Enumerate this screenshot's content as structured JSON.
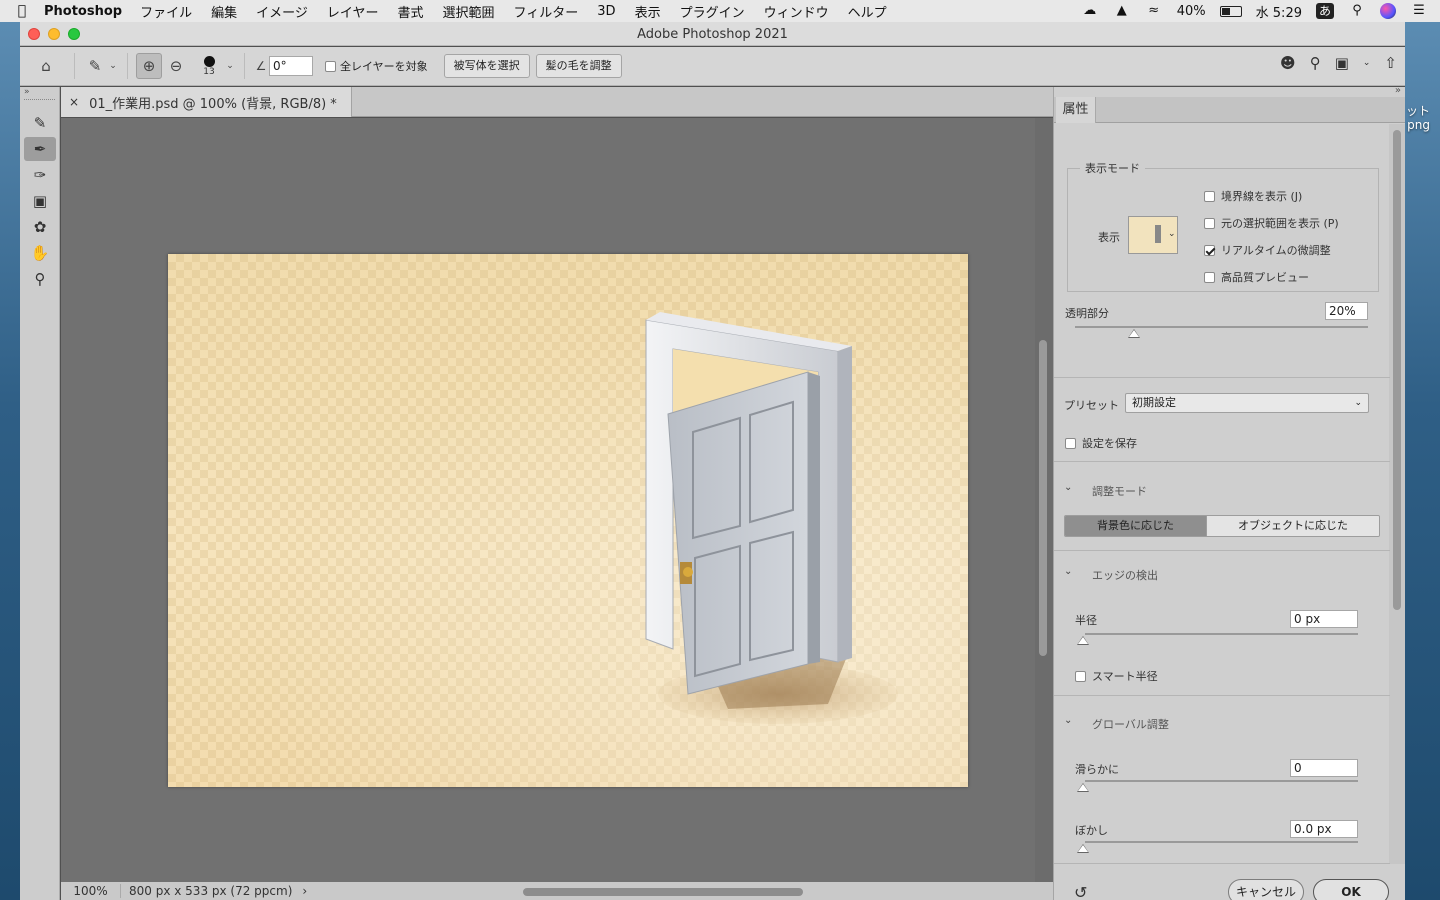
{
  "menubar": {
    "app_name": "Photoshop",
    "items": [
      "ファイル",
      "編集",
      "イメージ",
      "レイヤー",
      "書式",
      "選択範囲",
      "フィルター",
      "3D",
      "表示",
      "プラグイン",
      "ウィンドウ",
      "ヘルプ"
    ],
    "battery": "40%",
    "clock": "水 5:29",
    "ime": "あ"
  },
  "desktop": {
    "label_top": "ット",
    "label_bottom": "png"
  },
  "window": {
    "title": "Adobe Photoshop 2021"
  },
  "options": {
    "brush_size": "13",
    "angle_value": "0°",
    "sample_all_layers": "全レイヤーを対象",
    "select_subject": "被写体を選択",
    "refine_hair": "髪の毛を調整"
  },
  "document": {
    "tab_close": "×",
    "tab_title": "01_作業用.psd @ 100% (背景, RGB/8) *",
    "zoom": "100%",
    "info": "800 px x 533 px (72 ppcm)",
    "info_arrow": "›"
  },
  "panel": {
    "tab_label": "属性",
    "view_mode": {
      "title": "表示モード",
      "view_label": "表示",
      "options": [
        {
          "label": "境界線を表示 (J)",
          "checked": false
        },
        {
          "label": "元の選択範囲を表示 (P)",
          "checked": false
        },
        {
          "label": "リアルタイムの微調整",
          "checked": true
        },
        {
          "label": "高品質プレビュー",
          "checked": false
        }
      ]
    },
    "transparency": {
      "label": "透明部分",
      "value": "20%",
      "level": 0.2
    },
    "preset": {
      "label": "プリセット",
      "value": "初期設定"
    },
    "save_settings": "設定を保存",
    "adjust_mode": {
      "title": "調整モード",
      "options": [
        "背景色に応じた",
        "オブジェクトに応じた"
      ],
      "selected": 0
    },
    "edge_detection": {
      "title": "エッジの検出",
      "radius_label": "半径",
      "radius_value": "0 px",
      "smart_radius": "スマート半径"
    },
    "global": {
      "title": "グローバル調整",
      "smooth_label": "滑らかに",
      "smooth_value": "0",
      "feather_label": "ぼかし",
      "feather_value": "0.0 px"
    },
    "cancel": "キャンセル",
    "ok": "OK"
  }
}
